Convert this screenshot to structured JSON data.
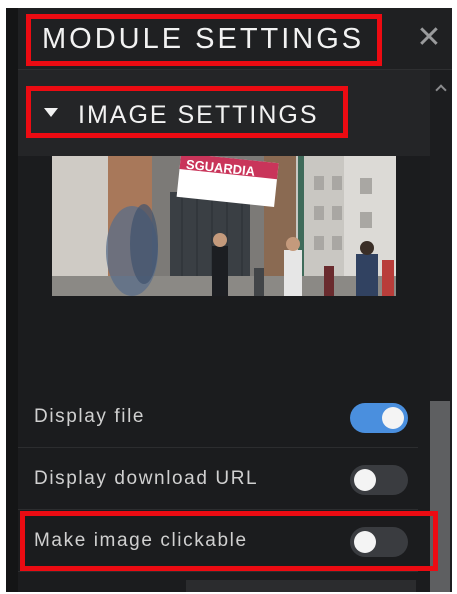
{
  "header": {
    "title": "MODULE SETTINGS",
    "close_glyph": "✕"
  },
  "section": {
    "title": "IMAGE SETTINGS",
    "expanded": true
  },
  "preview": {
    "sign_text": "SGUARDIA"
  },
  "settings": [
    {
      "label": "Display file",
      "enabled": true
    },
    {
      "label": "Display download URL",
      "enabled": false
    },
    {
      "label": "Make image clickable",
      "enabled": false
    }
  ],
  "colors": {
    "panel_bg": "#1b1c1e",
    "toggle_on": "#4a8fde",
    "toggle_off": "#3a3c40",
    "highlight": "#ec0b12"
  }
}
